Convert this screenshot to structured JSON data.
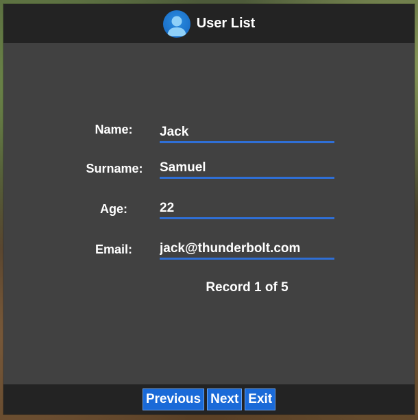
{
  "window": {
    "title": "User List",
    "icon": "user-icon"
  },
  "form": {
    "name_label": "Name:",
    "name_value": "Jack",
    "surname_label": "Surname:",
    "surname_value": "Samuel",
    "age_label": "Age:",
    "age_value": "22",
    "email_label": "Email:",
    "email_value": "jack@thunderbolt.com",
    "record_text": "Record 1 of 5"
  },
  "buttons": {
    "previous": "Previous",
    "next": "Next",
    "exit": "Exit"
  },
  "colors": {
    "accent": "#1a6ad8",
    "underline": "#2f6fd6",
    "panel": "#414141",
    "bar": "#232323"
  }
}
